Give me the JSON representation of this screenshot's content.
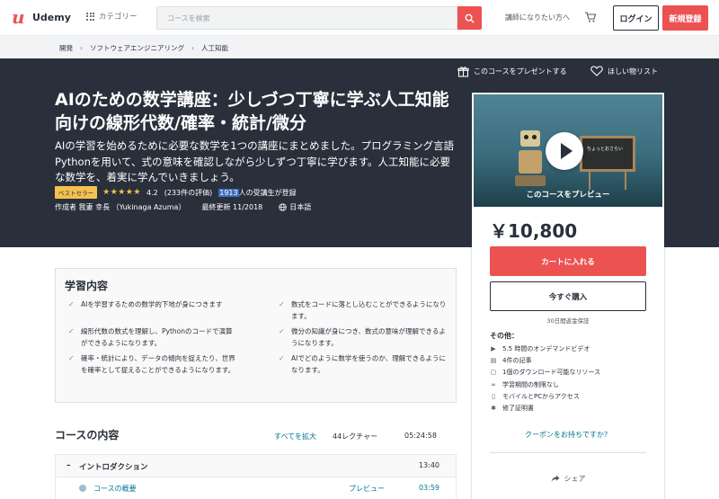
{
  "header": {
    "logo_text": "Udemy",
    "categories_label": "カテゴリー",
    "search_placeholder": "コースを検索",
    "teach_label": "講師になりたい方へ",
    "login_label": "ログイン",
    "signup_label": "新規登録"
  },
  "breadcrumb": [
    "開発",
    "ソフトウェアエンジニアリング",
    "人工知能"
  ],
  "hero": {
    "gift_label": "このコースをプレゼントする",
    "wishlist_label": "ほしい物リスト",
    "title": "AIのための数学講座：少しづつ丁寧に学ぶ人工知能向けの線形代数/確率・統計/微分",
    "subtitle": "AIの学習を始めるために必要な数学を1つの講座にまとめました。プログラミング言語Pythonを用いて、式の意味を確認しながら少しずつ丁寧に学びます。人工知能に必要な数学を、着実に学んでいきましょう。",
    "bestseller": "ベストセラー",
    "rating_value": "4.2",
    "rating_count": "(233件の評価)",
    "students_number": "1913",
    "students_suffix": "人の受講生が登録",
    "author": "作成者 我妻 幸長 （Yukinaga Azuma）",
    "updated": "最終更新 11/2018",
    "language": "日本語",
    "rating_stars": 4.2
  },
  "card": {
    "preview_label": "このコースをプレビュー",
    "board_text": "ちょっとおさらい",
    "price": "￥10,800",
    "cart_label": "カートに入れる",
    "buy_label": "今すぐ購入",
    "guarantee": "30日間返金保証",
    "includes_title": "その他：",
    "includes": [
      {
        "icon": "video-icon",
        "text": "5.5 時間のオンデマンドビデオ"
      },
      {
        "icon": "article-icon",
        "text": "4件の記事"
      },
      {
        "icon": "download-icon",
        "text": "1個のダウンロード可能なリソース"
      },
      {
        "icon": "infinity-icon",
        "text": "学習期間の制限なし"
      },
      {
        "icon": "mobile-icon",
        "text": "モバイルとPCからアクセス"
      },
      {
        "icon": "certificate-icon",
        "text": "修了証明書"
      }
    ],
    "coupon": "クーポンをお持ちですか？",
    "share": "シェア"
  },
  "learn": {
    "title": "学習内容",
    "items": [
      "AIを学習するための数学的下地が身につきます",
      "線形代数の数式を理解し、Pythonのコードで演算ができるようになります。",
      "確率・統計により、データの傾向を捉えたり、世界を確率として捉えることができるようになります。",
      "数式をコードに落とし込むことができるようになります。",
      "微分の知識が身につき、数式の意味が理解できるようになります。",
      "AIでどのように数学を使うのか、理解できるようになります。"
    ]
  },
  "content": {
    "title": "コースの内容",
    "expand_all": "すべてを拡大",
    "lecture_count": "44レクチャー",
    "total_time": "05:24:58",
    "sections": [
      {
        "toggle": "–",
        "label": "イントロダクション",
        "duration": "13:40"
      }
    ],
    "lectures": [
      {
        "label": "コースの概要",
        "preview": "プレビュー",
        "duration": "03:59"
      }
    ]
  }
}
